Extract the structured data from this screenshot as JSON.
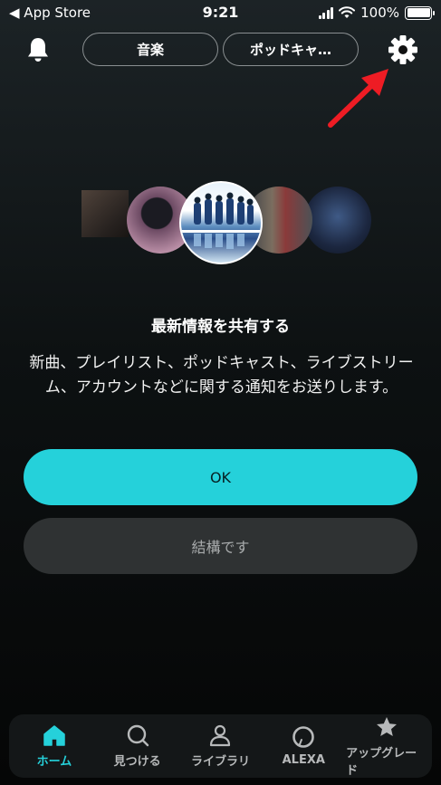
{
  "status_bar": {
    "back_label": "◀ App Store",
    "time": "9:21",
    "battery_percent": "100%"
  },
  "header": {
    "tabs": [
      {
        "label": "音楽"
      },
      {
        "label": "ポッドキャ…"
      }
    ]
  },
  "dialog": {
    "title": "最新情報を共有する",
    "description": "新曲、プレイリスト、ポッドキャスト、ライブストリーム、アカウントなどに関する通知をお送りします。",
    "ok_label": "OK",
    "decline_label": "結構です"
  },
  "bottom_nav": {
    "items": [
      {
        "label": "ホーム",
        "icon": "home-icon",
        "active": true
      },
      {
        "label": "見つける",
        "icon": "search-icon"
      },
      {
        "label": "ライブラリ",
        "icon": "person-icon"
      },
      {
        "label": "ALEXA",
        "icon": "alexa-icon"
      },
      {
        "label": "アップグレード",
        "icon": "star-icon"
      }
    ]
  },
  "colors": {
    "accent": "#25d1da",
    "arrow": "#ee1c24"
  }
}
